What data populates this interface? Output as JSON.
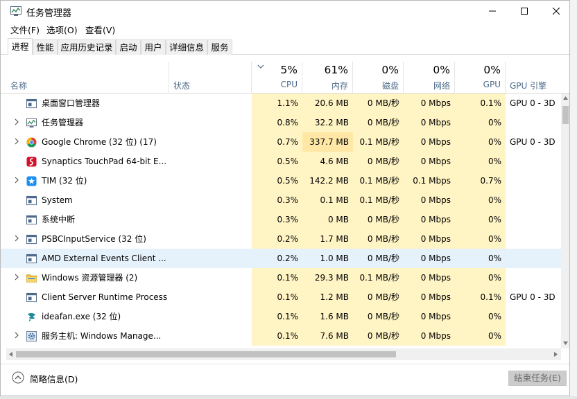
{
  "window": {
    "title": "任务管理器"
  },
  "menu": [
    "文件(F)",
    "选项(O)",
    "查看(V)"
  ],
  "tabs": [
    "进程",
    "性能",
    "应用历史记录",
    "启动",
    "用户",
    "详细信息",
    "服务"
  ],
  "columns": {
    "name": "名称",
    "status": "状态",
    "cpu": {
      "pct": "5%",
      "label": "CPU"
    },
    "mem": {
      "pct": "61%",
      "label": "内存"
    },
    "disk": {
      "pct": "0%",
      "label": "磁盘"
    },
    "net": {
      "pct": "0%",
      "label": "网络"
    },
    "gpu": {
      "pct": "0%",
      "label": "GPU"
    },
    "gpuengine": "GPU 引擎"
  },
  "rows": [
    {
      "name": "桌面窗口管理器",
      "icon": "window-icon",
      "expand": false,
      "cpu": "1.1%",
      "mem": "20.6 MB",
      "disk": "0 MB/秒",
      "net": "0 Mbps",
      "gpu": "0.1%",
      "engine": "GPU 0 - 3D",
      "memhi": false
    },
    {
      "name": "任务管理器",
      "icon": "taskmgr-icon",
      "expand": true,
      "cpu": "0.8%",
      "mem": "32.2 MB",
      "disk": "0 MB/秒",
      "net": "0 Mbps",
      "gpu": "0%",
      "engine": "",
      "memhi": false
    },
    {
      "name": "Google Chrome (32 位) (17)",
      "icon": "chrome-icon",
      "expand": true,
      "cpu": "0.7%",
      "mem": "337.7 MB",
      "disk": "0.1 MB/秒",
      "net": "0 Mbps",
      "gpu": "0%",
      "engine": "GPU 0 - 3D",
      "memhi": true
    },
    {
      "name": "Synaptics TouchPad 64-bit E...",
      "icon": "synaptics-icon",
      "expand": false,
      "cpu": "0.5%",
      "mem": "4.6 MB",
      "disk": "0 MB/秒",
      "net": "0 Mbps",
      "gpu": "0%",
      "engine": "",
      "memhi": false
    },
    {
      "name": "TIM (32 位)",
      "icon": "tim-icon",
      "expand": true,
      "cpu": "0.5%",
      "mem": "142.2 MB",
      "disk": "0.1 MB/秒",
      "net": "0.1 Mbps",
      "gpu": "0.7%",
      "engine": "",
      "memhi": false
    },
    {
      "name": "System",
      "icon": "window-icon",
      "expand": false,
      "cpu": "0.3%",
      "mem": "0.1 MB",
      "disk": "0.1 MB/秒",
      "net": "0 Mbps",
      "gpu": "0%",
      "engine": "",
      "memhi": false
    },
    {
      "name": "系统中断",
      "icon": "window-icon",
      "expand": false,
      "cpu": "0.3%",
      "mem": "0 MB",
      "disk": "0 MB/秒",
      "net": "0 Mbps",
      "gpu": "0%",
      "engine": "",
      "memhi": false
    },
    {
      "name": "PSBCInputService (32 位)",
      "icon": "window-icon",
      "expand": true,
      "cpu": "0.2%",
      "mem": "1.7 MB",
      "disk": "0 MB/秒",
      "net": "0 Mbps",
      "gpu": "0%",
      "engine": "",
      "memhi": false
    },
    {
      "name": "AMD External Events Client ...",
      "icon": "window-icon",
      "expand": false,
      "cpu": "0.2%",
      "mem": "1.0 MB",
      "disk": "0 MB/秒",
      "net": "0 Mbps",
      "gpu": "0%",
      "engine": "",
      "memhi": false,
      "selected": true
    },
    {
      "name": "Windows 资源管理器 (2)",
      "icon": "folder-icon",
      "expand": true,
      "cpu": "0.1%",
      "mem": "29.3 MB",
      "disk": "0.1 MB/秒",
      "net": "0 Mbps",
      "gpu": "0%",
      "engine": "",
      "memhi": false
    },
    {
      "name": "Client Server Runtime Process",
      "icon": "window-icon",
      "expand": false,
      "cpu": "0.1%",
      "mem": "1.2 MB",
      "disk": "0 MB/秒",
      "net": "0 Mbps",
      "gpu": "0.1%",
      "engine": "GPU 0 - 3D",
      "memhi": false
    },
    {
      "name": "ideafan.exe (32 位)",
      "icon": "fan-icon",
      "expand": false,
      "cpu": "0.1%",
      "mem": "1.6 MB",
      "disk": "0 MB/秒",
      "net": "0 Mbps",
      "gpu": "0%",
      "engine": "",
      "memhi": false
    },
    {
      "name": "服务主机: Windows Manage...",
      "icon": "gear-icon",
      "expand": true,
      "cpu": "0.1%",
      "mem": "7.6 MB",
      "disk": "0 MB/秒",
      "net": "0 Mbps",
      "gpu": "0%",
      "engine": "",
      "memhi": false
    }
  ],
  "footer": {
    "fewer": "简略信息(D)",
    "end_task": "结束任务(E)"
  }
}
